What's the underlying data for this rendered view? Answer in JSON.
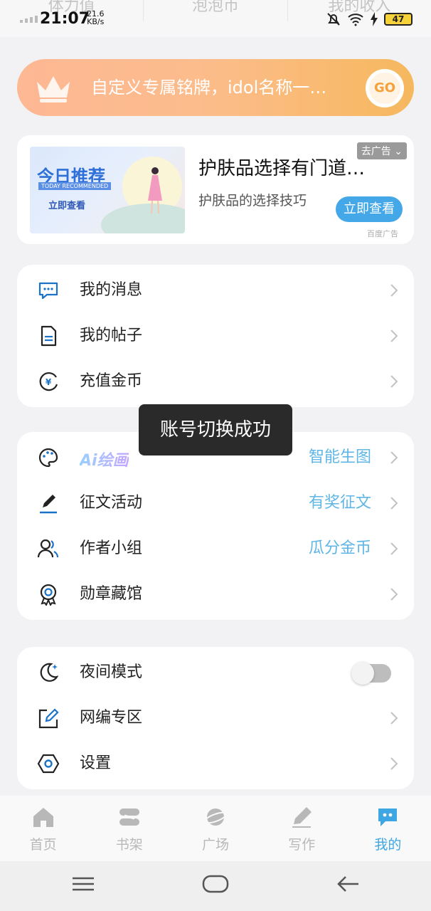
{
  "top_stats": [
    "体力值",
    "泡泡币",
    "我的收入"
  ],
  "status_bar": {
    "time": "21:07",
    "net_speed": "21.6",
    "net_unit": "KB/s",
    "battery": "47"
  },
  "banner": {
    "text": "自定义专属铭牌，idol名称一…",
    "go_label": "GO"
  },
  "ad": {
    "image_title": "今日推荐",
    "image_subtitle": "TODAY RECOMMENDED",
    "image_cta": "立即查看",
    "title": "护肤品选择有门道…",
    "description": "护肤品的选择技巧",
    "close_label": "去广告",
    "button_label": "立即查看",
    "source": "百度广告"
  },
  "menu_group_1": [
    {
      "label": "我的消息",
      "icon": "message-icon"
    },
    {
      "label": "我的帖子",
      "icon": "document-icon"
    },
    {
      "label": "充值金币",
      "icon": "coin-icon"
    }
  ],
  "menu_group_2": [
    {
      "label": "Ai绘画",
      "icon": "palette-icon",
      "side": "智能生图"
    },
    {
      "label": "征文活动",
      "icon": "pen-icon",
      "side": "有奖征文"
    },
    {
      "label": "作者小组",
      "icon": "group-icon",
      "side": "瓜分金币"
    },
    {
      "label": "勋章藏馆",
      "icon": "medal-icon",
      "side": ""
    }
  ],
  "menu_group_3": [
    {
      "label": "夜间模式",
      "icon": "moon-icon",
      "toggle_on": false
    },
    {
      "label": "网编专区",
      "icon": "edit-box-icon"
    },
    {
      "label": "设置",
      "icon": "settings-icon"
    }
  ],
  "toast": "账号切换成功",
  "bottom_nav": [
    {
      "label": "首页",
      "icon": "home-icon",
      "active": false
    },
    {
      "label": "书架",
      "icon": "bookshelf-icon",
      "active": false
    },
    {
      "label": "广场",
      "icon": "planet-icon",
      "active": false
    },
    {
      "label": "写作",
      "icon": "write-icon",
      "active": false
    },
    {
      "label": "我的",
      "icon": "profile-chat-icon",
      "active": true
    }
  ],
  "colors": {
    "accent": "#3ea6e3",
    "banner_start": "#fdb894",
    "banner_end": "#f6b85d",
    "side_text": "#5fb6e6"
  }
}
